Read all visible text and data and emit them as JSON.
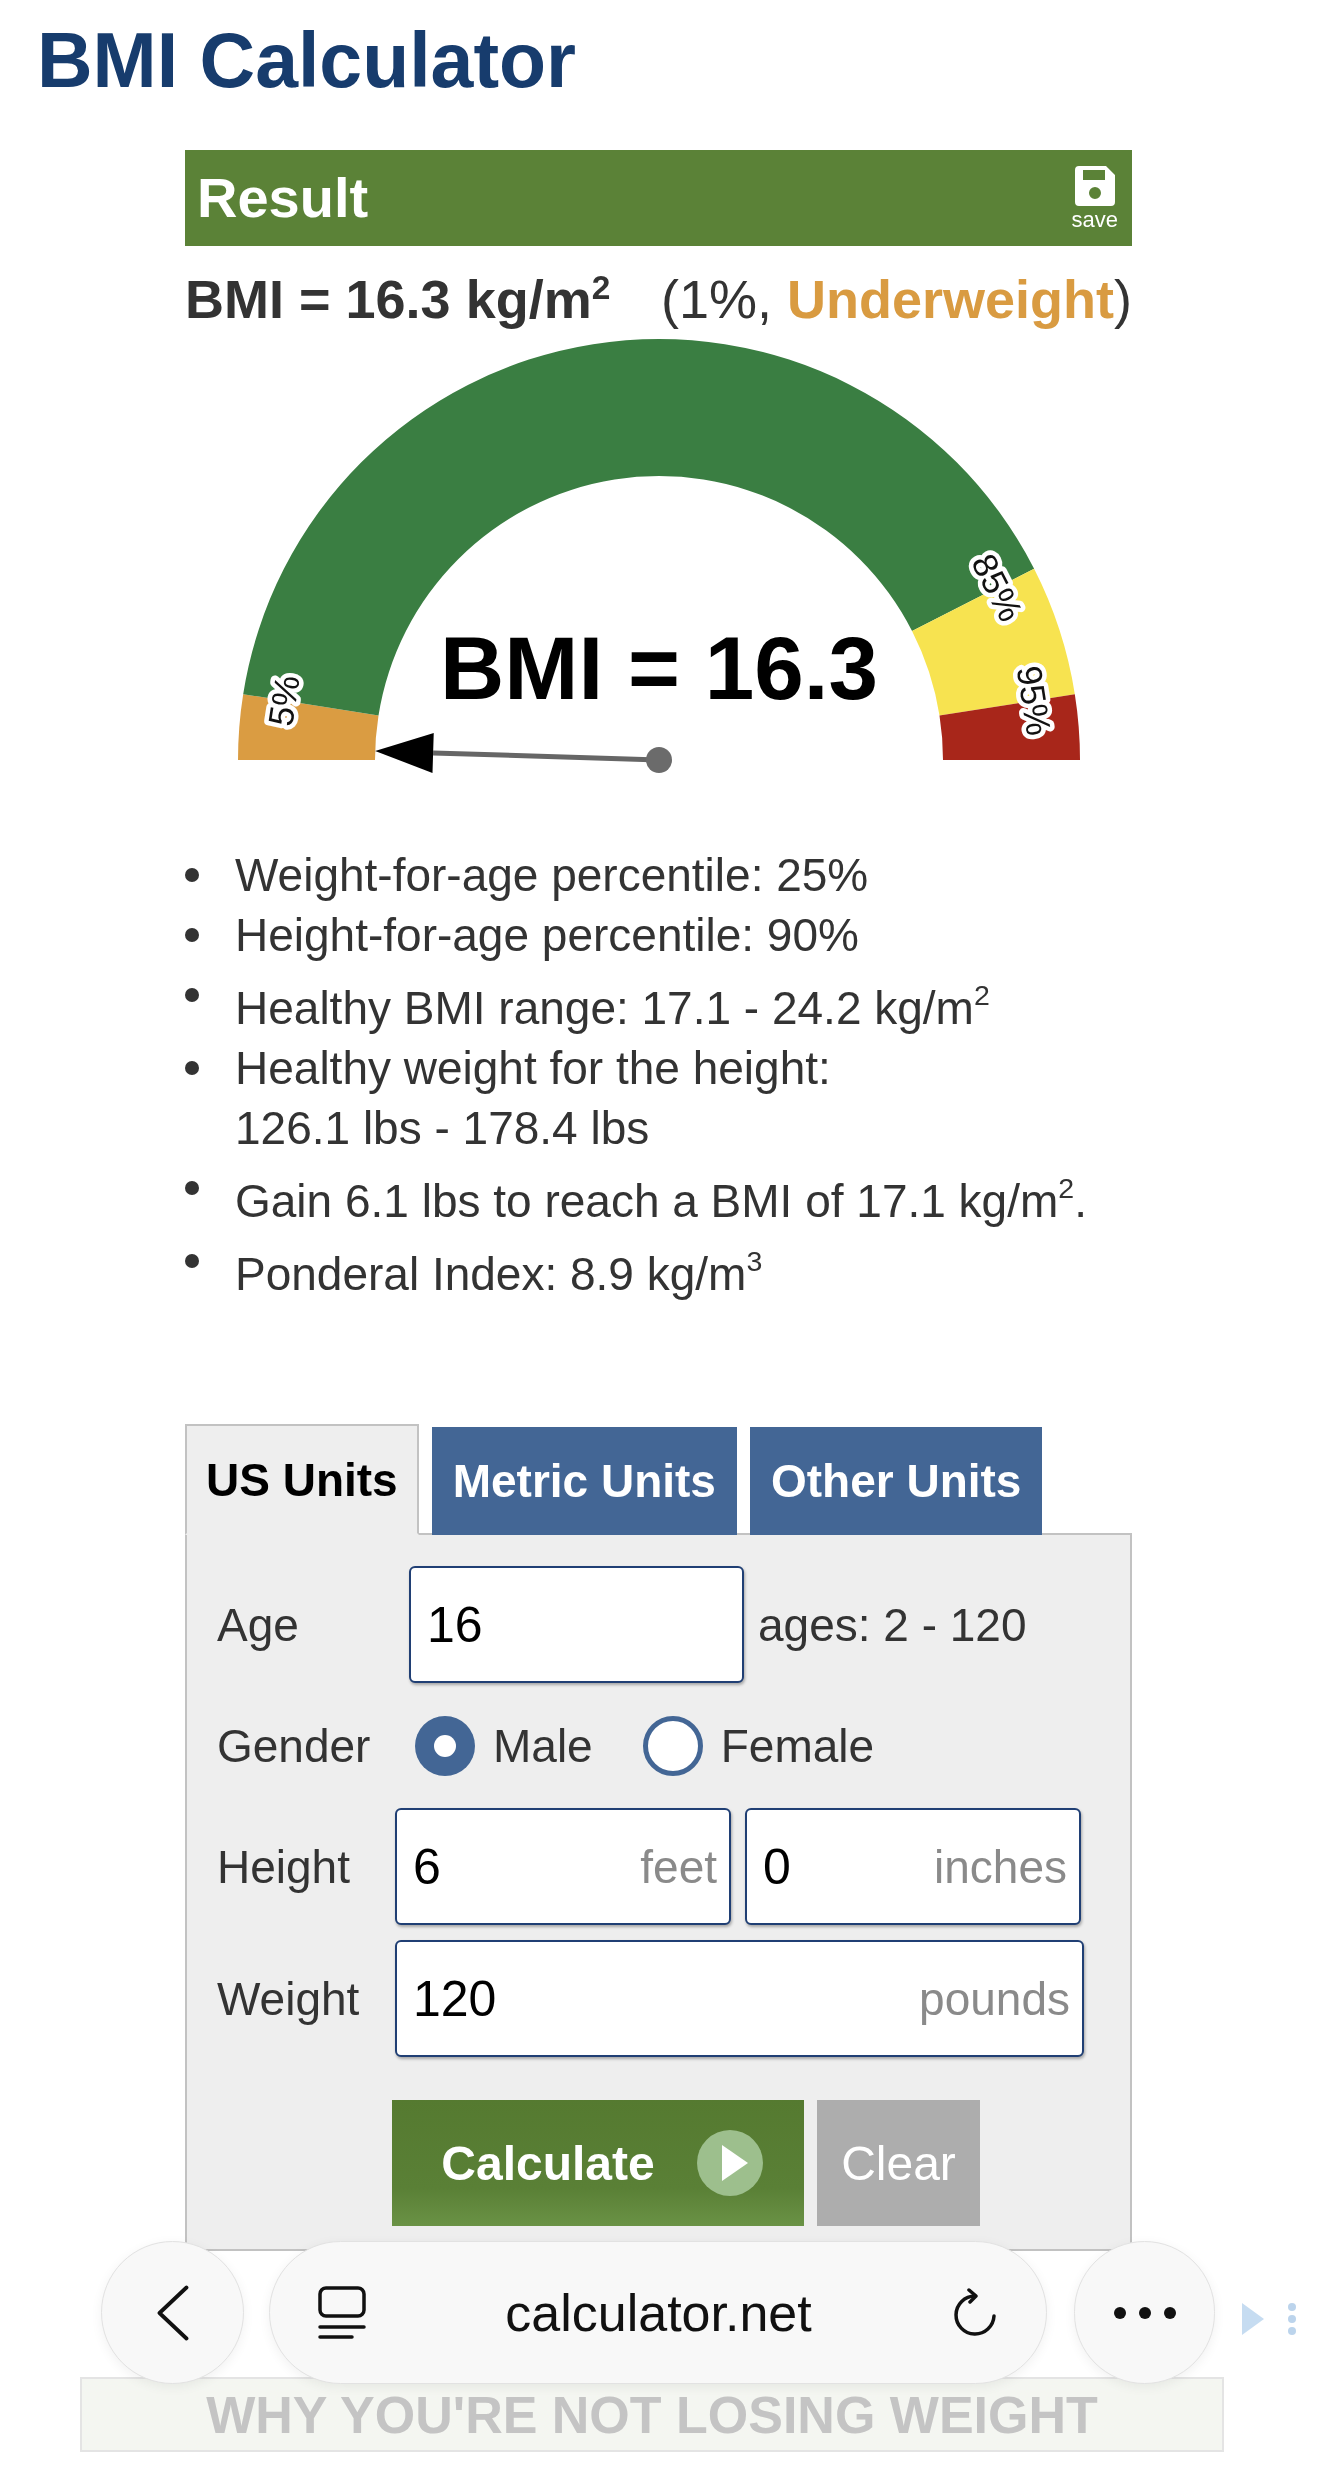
{
  "page_title": "BMI Calculator",
  "result": {
    "title": "Result",
    "save_label": "save",
    "bmi": "BMI = 16.3 kg/m$^{2}$",
    "classification": "(1%, **Underweight**)",
    "gauge": {
      "readout": "BMI = 16.3",
      "bands": [
        {
          "color": "#da9c42"
        },
        {
          "color": "#3a7e42"
        },
        {
          "color": "#f7e350"
        },
        {
          "color": "#a8261a"
        }
      ],
      "ticks": [
        "5%",
        "85%",
        "95%"
      ]
    },
    "details": [
      "Weight-for-age percentile: 25%",
      "Height-for-age percentile: 90%",
      "Healthy BMI range: 17.1 - 24.2 kg/m$^{2}$",
      "Healthy weight for the height:\n126.1 lbs - 178.4 lbs",
      "Gain 6.1 lbs to reach a BMI of 17.1 kg/m$^{2}$.",
      "Ponderal Index: 8.9 kg/m$^{3}$"
    ]
  },
  "form": {
    "tabs": [
      {
        "label": "US Units",
        "selected": true
      },
      {
        "label": "Metric Units",
        "selected": false
      },
      {
        "label": "Other Units",
        "selected": false
      }
    ],
    "rows": [
      {
        "kind": "inputs",
        "label": "Age",
        "inputs": [
          {
            "value": "16"
          }
        ],
        "hint": "ages: 2 - 120"
      },
      {
        "kind": "radios",
        "label": "Gender",
        "options": [
          {
            "label": "Male",
            "selected": true
          },
          {
            "label": "Female",
            "selected": false
          }
        ]
      },
      {
        "kind": "inputs",
        "label": "Height",
        "inputs": [
          {
            "value": "6",
            "unit": "feet"
          },
          {
            "value": "0",
            "unit": "inches"
          }
        ]
      },
      {
        "kind": "inputs",
        "label": "Weight",
        "inputs": [
          {
            "value": "120",
            "unit": "pounds"
          }
        ]
      }
    ],
    "buttons": [
      {
        "label": "Calculate",
        "kind": "primary"
      },
      {
        "label": "Clear",
        "kind": "secondary"
      }
    ]
  },
  "ad": {
    "headline": "WHY YOU'RE NOT LOSING WEIGHT"
  },
  "browser": {
    "url": "calculator.net"
  }
}
